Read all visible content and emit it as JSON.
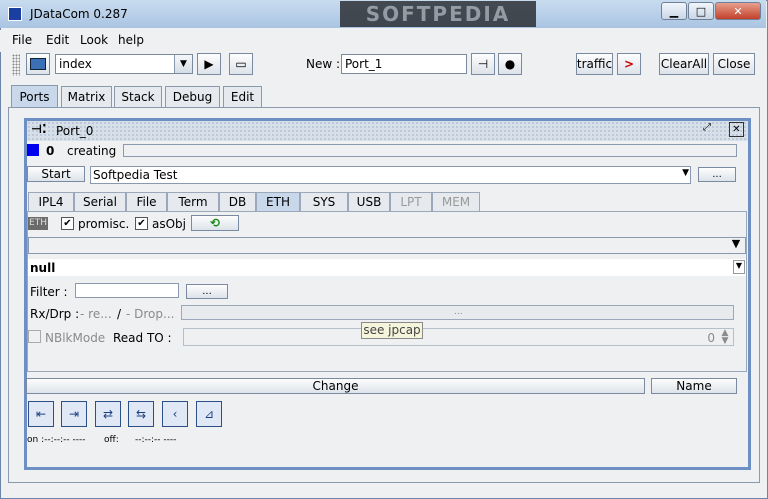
{
  "window": {
    "title": "JDataCom 0.287",
    "watermark": "SOFTPEDIA"
  },
  "menu": {
    "items": [
      "File",
      "Edit",
      "Look",
      "help"
    ]
  },
  "toolbar": {
    "index_value": "index",
    "new_label": "New :",
    "new_value": "Port_1",
    "traffic_label": "traffic",
    "clearall_label": "ClearAll",
    "close_label": "Close"
  },
  "main_tabs": [
    "Ports",
    "Matrix",
    "Stack",
    "Debug",
    "Edit"
  ],
  "port": {
    "title": "Port_0",
    "status_count": "0",
    "status_text": "creating",
    "start_label": "Start",
    "start_value": "Softpedia Test",
    "browse_label": "...",
    "tabs": [
      "IPL4",
      "Serial",
      "File",
      "Term",
      "DB",
      "ETH",
      "SYS",
      "USB",
      "LPT",
      "MEM"
    ],
    "eth": {
      "eth_badge": "ETH",
      "promisc_label": "promisc.",
      "asobj_label": "asObj",
      "null_text": "null",
      "filter_label": "Filter :",
      "filter_btn": "...",
      "rxdrp_label": "Rx/Drp :",
      "re_text": "- re...",
      "slash": "/",
      "drop_text": "- Drop...",
      "drop_bar_text": "...",
      "nblk_label": "NBlkMode",
      "readto_label": "Read TO :",
      "readto_value": "0",
      "tooltip": "see jpcap"
    },
    "change_label": "Change",
    "name_label": "Name",
    "footer_on": "on :--:--:-- ----",
    "footer_off": "off:",
    "footer_off_val": "--:--:-- ----"
  },
  "colors": {
    "status_square": "#0000ee",
    "frame_border": "#6d8fc4"
  }
}
